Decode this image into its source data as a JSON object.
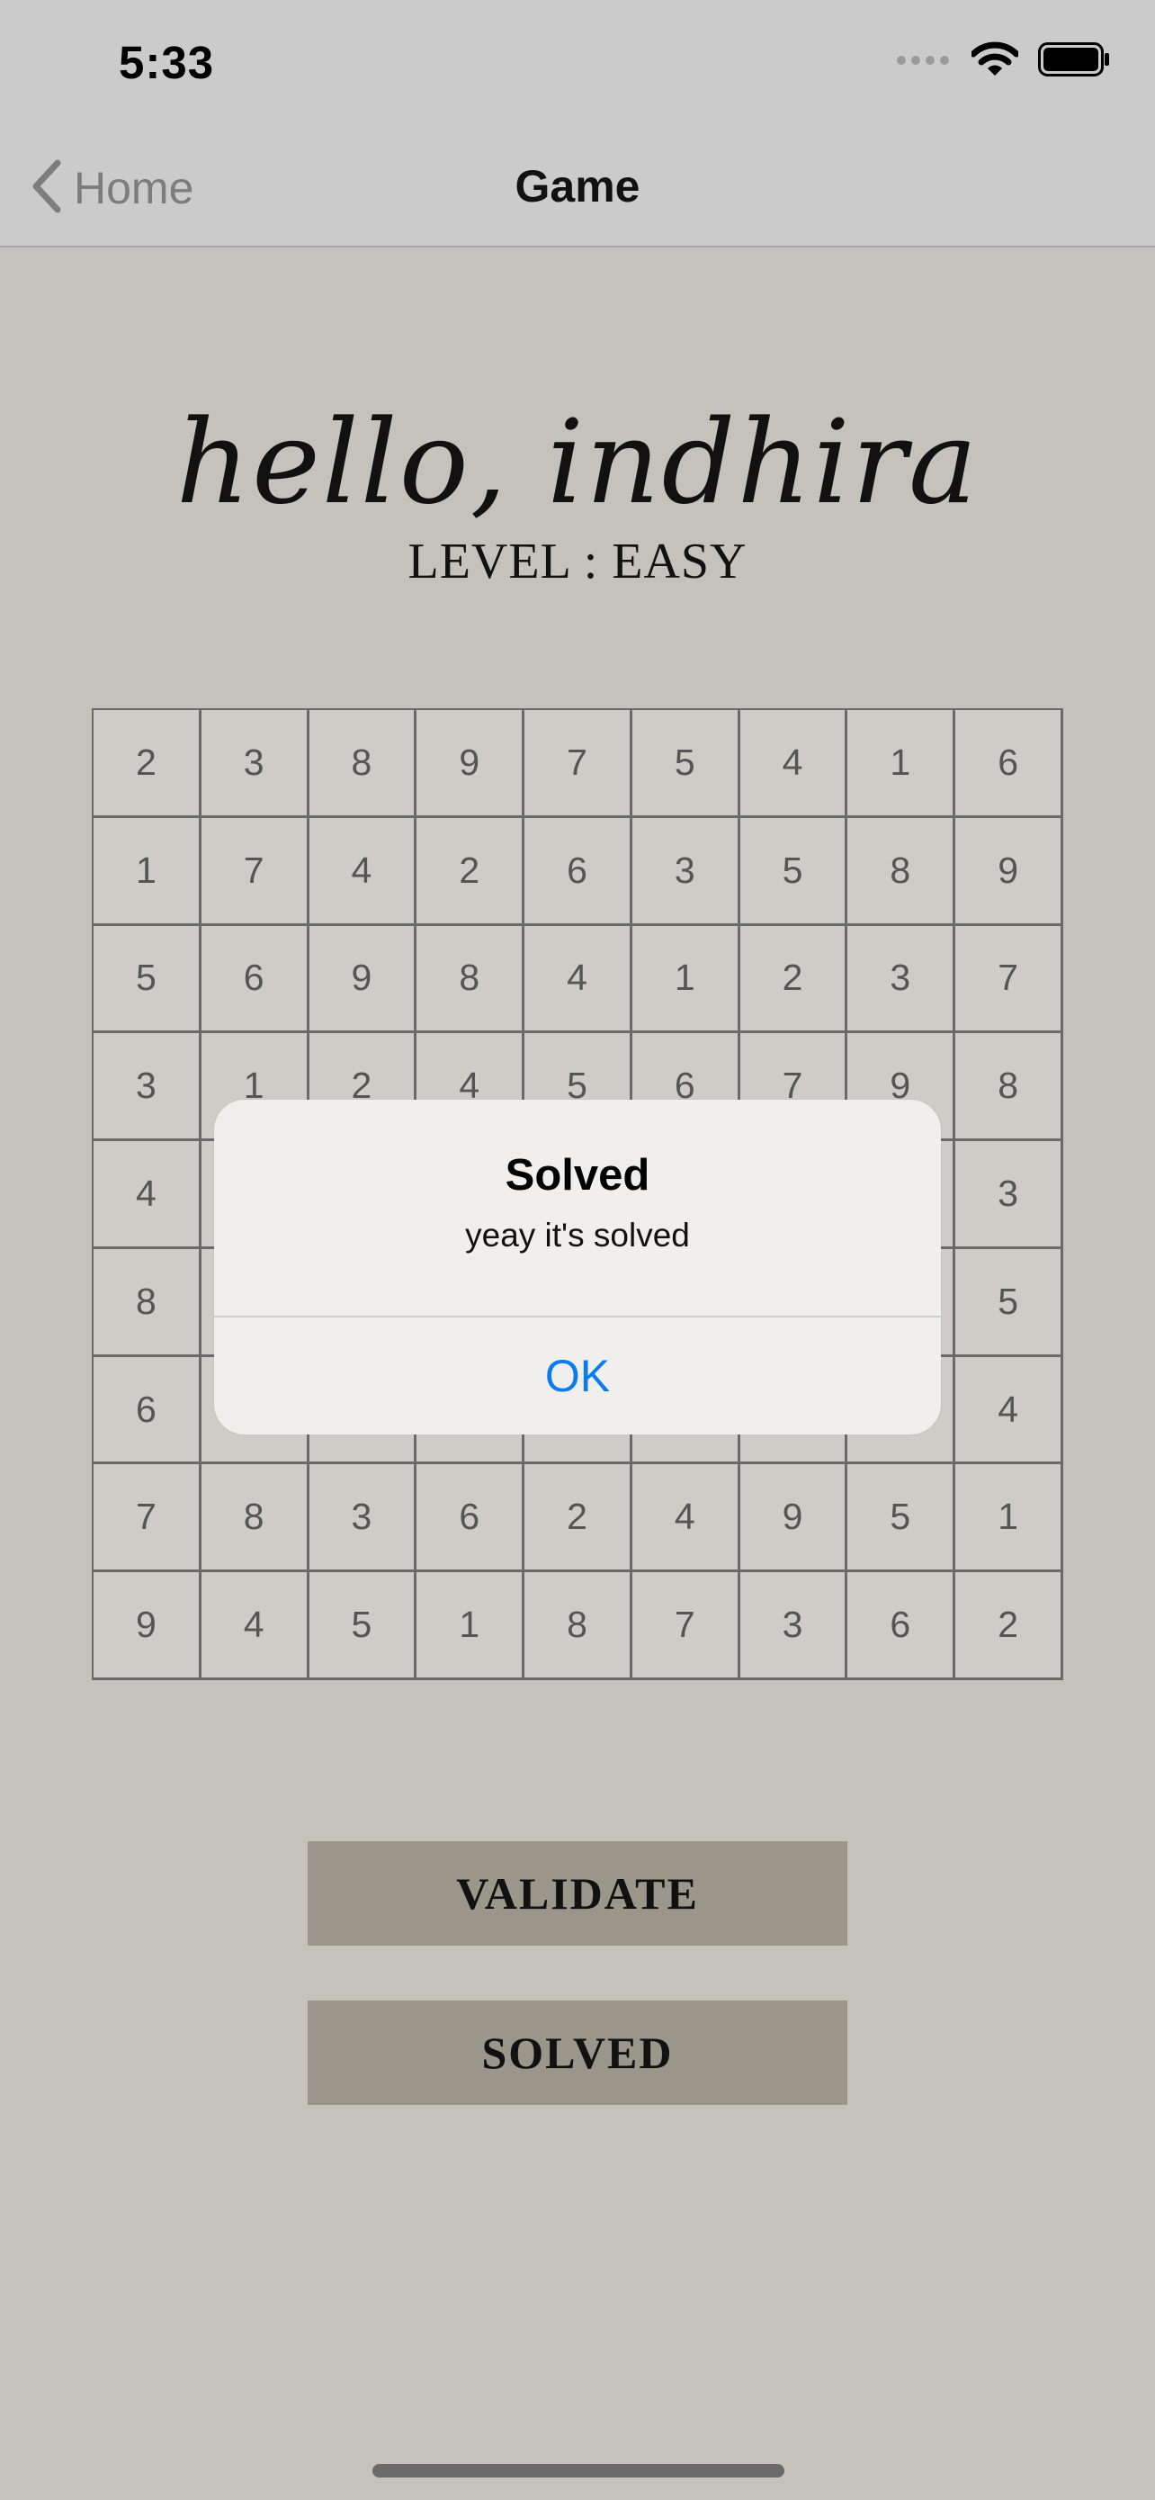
{
  "status": {
    "time": "5:33",
    "icons": [
      "signal-dots-icon",
      "wifi-icon",
      "battery-icon"
    ]
  },
  "nav": {
    "back_label": "Home",
    "title": "Game"
  },
  "header": {
    "greeting": "hello, indhira",
    "level": "LEVEL : EASY"
  },
  "board": {
    "rows": [
      [
        "2",
        "3",
        "8",
        "9",
        "7",
        "5",
        "4",
        "1",
        "6"
      ],
      [
        "1",
        "7",
        "4",
        "2",
        "6",
        "3",
        "5",
        "8",
        "9"
      ],
      [
        "5",
        "6",
        "9",
        "8",
        "4",
        "1",
        "2",
        "3",
        "7"
      ],
      [
        "3",
        "1",
        "2",
        "4",
        "5",
        "6",
        "7",
        "9",
        "8"
      ],
      [
        "4",
        "",
        "",
        "",
        "",
        "",
        "",
        "",
        "3"
      ],
      [
        "8",
        "",
        "",
        "",
        "",
        "",
        "",
        "",
        "5"
      ],
      [
        "6",
        "",
        "",
        "",
        "",
        "",
        "",
        "",
        "4"
      ],
      [
        "7",
        "8",
        "3",
        "6",
        "2",
        "4",
        "9",
        "5",
        "1"
      ],
      [
        "9",
        "4",
        "5",
        "1",
        "8",
        "7",
        "3",
        "6",
        "2"
      ]
    ]
  },
  "alert": {
    "title": "Solved",
    "message": "yeay it's solved",
    "ok_label": "OK"
  },
  "buttons": {
    "validate_label": "VALIDATE",
    "solved_label": "SOLVED"
  },
  "colors": {
    "background": "#c5c1bb",
    "cell": "#cfcbc7",
    "button": "#9a968a",
    "accent": "#0a7cf0"
  }
}
